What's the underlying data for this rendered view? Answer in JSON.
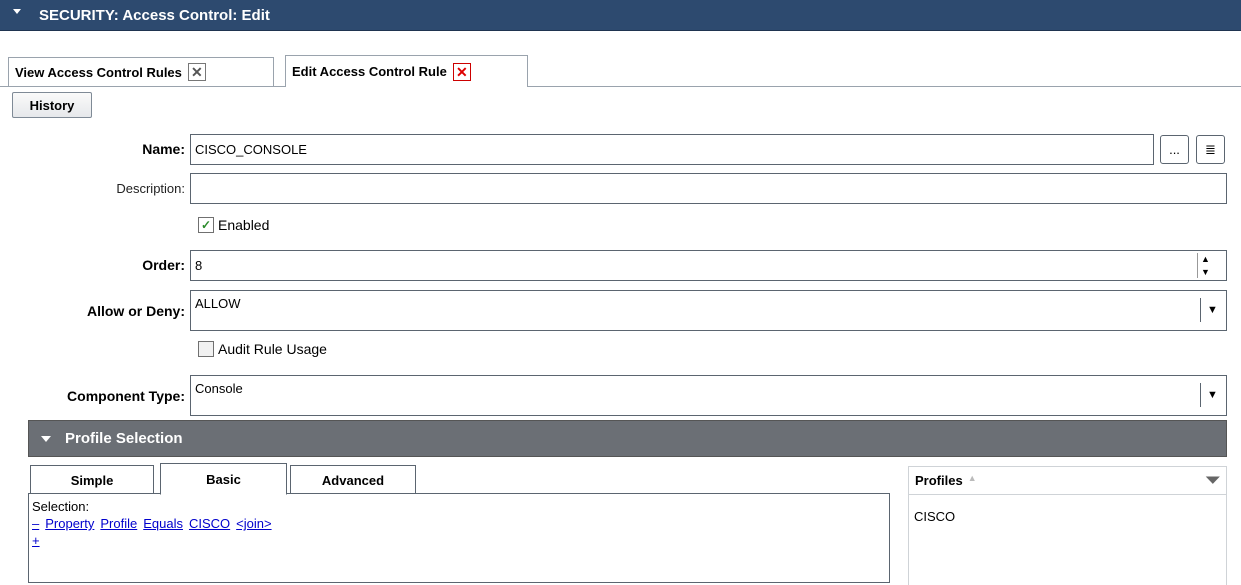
{
  "window": {
    "title": "SECURITY: Access Control: Edit"
  },
  "tabs": [
    {
      "label": "View Access Control Rules",
      "close": "✕"
    },
    {
      "label": "Edit Access Control Rule",
      "close": "✕"
    }
  ],
  "toolbar": {
    "history_label": "History"
  },
  "form": {
    "name": {
      "label": "Name:",
      "value": "CISCO_CONSOLE",
      "browse": "...",
      "details": "≣"
    },
    "description": {
      "label": "Description:",
      "value": ""
    },
    "enabled": {
      "label": "Enabled",
      "checked": true,
      "mark": "✓"
    },
    "order": {
      "label": "Order:",
      "value": "8",
      "up": "▲",
      "down": "▼"
    },
    "allow_deny": {
      "label": "Allow or Deny:",
      "value": "ALLOW",
      "arrow": "▼"
    },
    "audit": {
      "label": "Audit Rule Usage",
      "checked": false
    },
    "component_type": {
      "label": "Component Type:",
      "value": "Console",
      "arrow": "▼"
    }
  },
  "profile_selection": {
    "title": "Profile Selection",
    "tabs": [
      "Simple",
      "Basic",
      "Advanced"
    ],
    "active_tab": "Basic",
    "selection_label": "Selection:",
    "rule_tokens": [
      "–",
      "Property",
      "Profile",
      "Equals",
      "CISCO",
      "<join>"
    ],
    "add_token": "+",
    "profiles_header": "Profiles",
    "sort_icon": "▲",
    "filter_icon": "⏷",
    "profiles": [
      "CISCO"
    ]
  }
}
